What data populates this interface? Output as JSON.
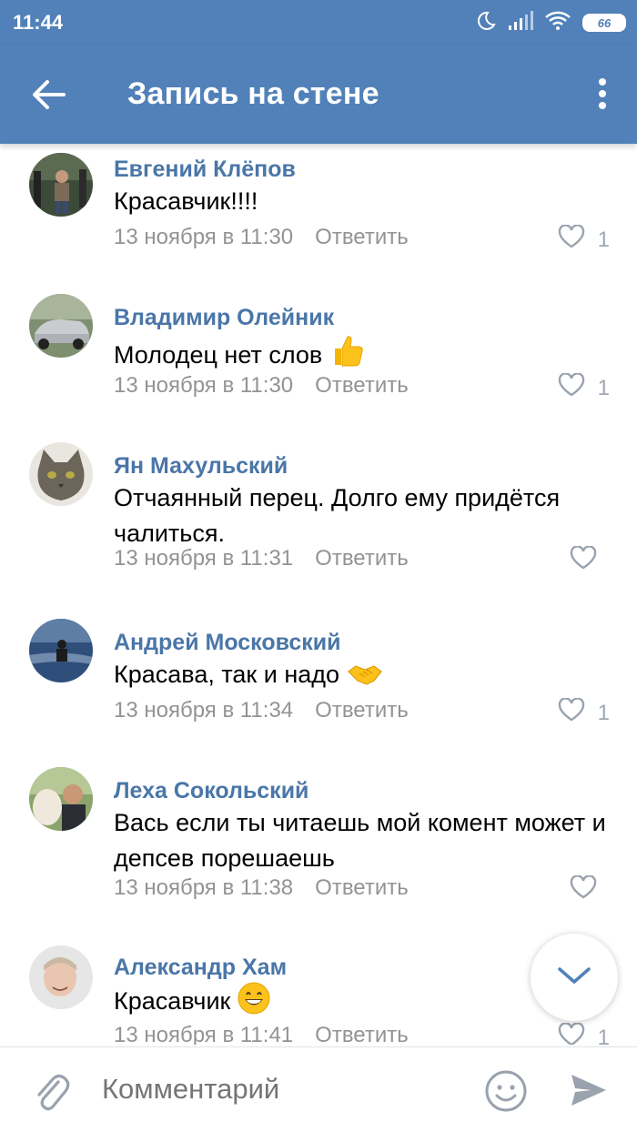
{
  "status_bar": {
    "time": "11:44",
    "battery": "66"
  },
  "header": {
    "title": "Запись на стене"
  },
  "comments": [
    {
      "author": "Евгений Клёпов",
      "text": "Красавчик!!!!",
      "date": "13 ноября в 11:30",
      "reply": "Ответить",
      "likes": "1",
      "emoji": ""
    },
    {
      "author": "Владимир Олейник",
      "text": "Молодец нет слов",
      "date": "13 ноября в 11:30",
      "reply": "Ответить",
      "likes": "1",
      "emoji": "thumbs-up"
    },
    {
      "author": "Ян Махульский",
      "text": "Отчаянный перец. Долго ему придётся чалиться.",
      "date": "13 ноября в 11:31",
      "reply": "Ответить",
      "likes": "",
      "emoji": ""
    },
    {
      "author": "Андрей Московский",
      "text": "Красава, так и надо",
      "date": "13 ноября в 11:34",
      "reply": "Ответить",
      "likes": "1",
      "emoji": "handshake"
    },
    {
      "author": "Леха Сокольский",
      "text": "Вась если ты читаешь мой комент может и депсев порешаешь",
      "date": "13 ноября в 11:38",
      "reply": "Ответить",
      "likes": "",
      "emoji": ""
    },
    {
      "author": "Александр Хам",
      "text": "Красавчик",
      "date": "13 ноября в 11:41",
      "reply": "Ответить",
      "likes": "1",
      "emoji": "grinning-face"
    }
  ],
  "composer": {
    "placeholder": "Комментарий"
  },
  "colors": {
    "brand": "#5181b8",
    "author": "#4a76a8",
    "meta": "#939393"
  }
}
